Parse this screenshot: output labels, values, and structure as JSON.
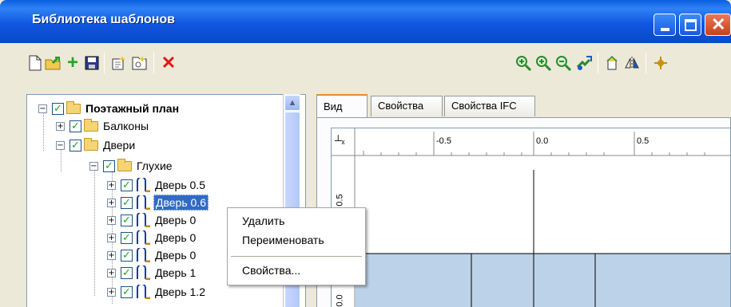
{
  "window": {
    "title": "Библиотека шаблонов",
    "controls": [
      "minimize",
      "maximize",
      "close"
    ]
  },
  "toolbar": {
    "left_icons": [
      "new-document-icon",
      "open-folder-icon",
      "add-plus-icon",
      "save-icon",
      "new-template-icon",
      "properties-icon",
      "delete-icon"
    ],
    "right_icons": [
      "zoom-all-icon",
      "zoom-in-icon",
      "zoom-out-icon",
      "zoom-window-icon",
      "rotate-icon",
      "mirror-icon",
      "center-icon"
    ]
  },
  "tree": {
    "nodes": [
      {
        "label": "Поэтажный план",
        "level": 0,
        "expanded": true,
        "checked": true,
        "icon": "folder-icon",
        "bold": true
      },
      {
        "label": "Балконы",
        "level": 1,
        "expanded": false,
        "checked": true,
        "icon": "folder-icon"
      },
      {
        "label": "Двери",
        "level": 1,
        "expanded": true,
        "checked": true,
        "icon": "folder-icon"
      },
      {
        "label": "Глухие",
        "level": 2,
        "expanded": true,
        "checked": true,
        "icon": "folder-icon"
      },
      {
        "label": "Дверь 0.5",
        "level": 3,
        "expanded": false,
        "checked": true,
        "icon": "door-icon"
      },
      {
        "label": "Дверь 0.6",
        "level": 3,
        "expanded": false,
        "checked": true,
        "icon": "door-icon",
        "selected": true
      },
      {
        "label": "Дверь 0",
        "level": 3,
        "expanded": false,
        "checked": true,
        "icon": "door-icon"
      },
      {
        "label": "Дверь 0",
        "level": 3,
        "expanded": false,
        "checked": true,
        "icon": "door-icon"
      },
      {
        "label": "Дверь 0",
        "level": 3,
        "expanded": false,
        "checked": true,
        "icon": "door-icon"
      },
      {
        "label": "Дверь 1",
        "level": 3,
        "expanded": false,
        "checked": true,
        "icon": "door-icon"
      },
      {
        "label": "Дверь 1.2",
        "level": 3,
        "expanded": false,
        "checked": true,
        "icon": "door-icon"
      }
    ]
  },
  "context_menu": {
    "items": [
      "Удалить",
      "Переименовать",
      "Свойства..."
    ]
  },
  "tabs": [
    "Вид",
    "Свойства",
    "Свойства IFC"
  ],
  "active_tab": "Вид",
  "preview": {
    "ruler_top_labels": [
      "-0.5",
      "0.0",
      "0.5"
    ],
    "ruler_left_labels": [
      "0.5",
      "0.0"
    ],
    "axis_glyph": "┴ₓ",
    "fill_color": "#bcd2e8",
    "line_color": "#000000"
  }
}
